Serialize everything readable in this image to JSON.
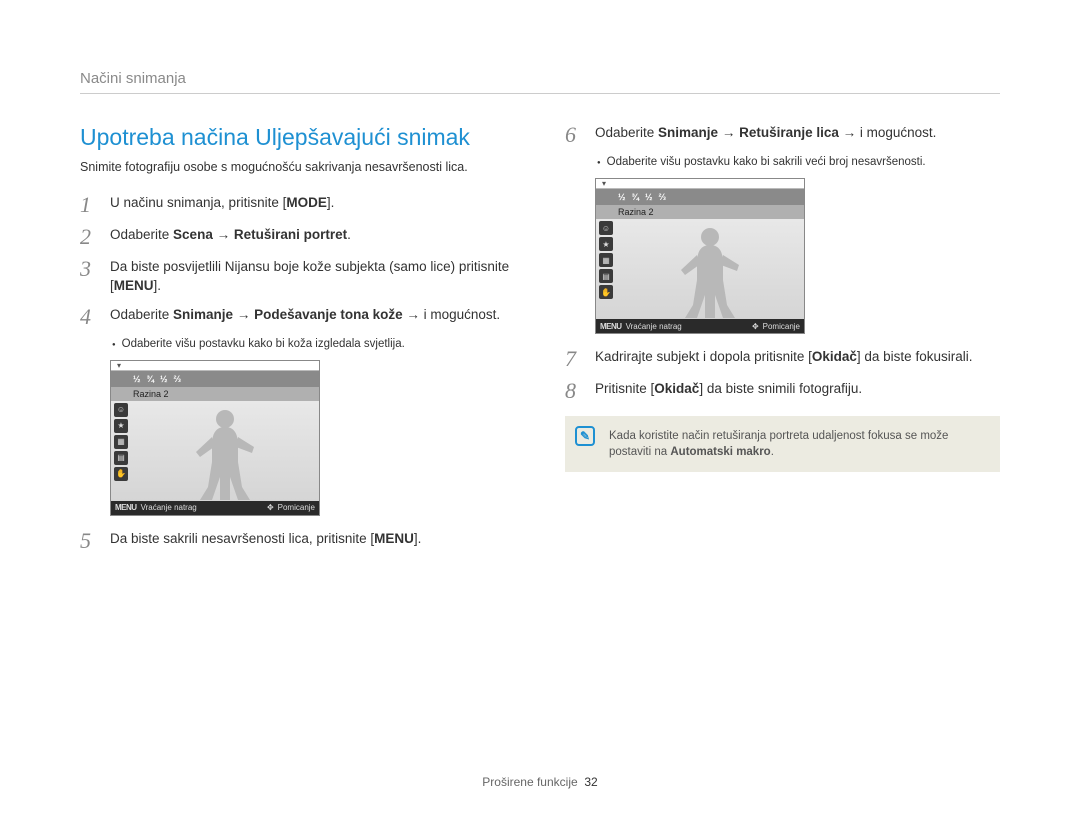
{
  "breadcrumb": "Načini snimanja",
  "section_title": "Upotreba načina Uljepšavajući snimak",
  "intro": "Snimite fotografiju osobe s mogućnošću sakrivanja nesavršenosti lica.",
  "steps_left": [
    {
      "n": "1",
      "html": "U načinu snimanja, pritisnite [<b>MODE</b>]."
    },
    {
      "n": "2",
      "html": "Odaberite <b>Scena → Retuširani portret</b>."
    },
    {
      "n": "3",
      "html": "Da biste posvijetlili Nijansu boje kože subjekta (samo lice) pritisnite [<b>MENU</b>]."
    },
    {
      "n": "4",
      "html": "Odaberite <b>Snimanje → Podešavanje tona kože →</b> i mogućnost."
    }
  ],
  "sub_bullet_left": "Odaberite višu postavku kako bi koža izgledala svjetlija.",
  "step5": {
    "n": "5",
    "html": "Da biste sakrili nesavršenosti lica, pritisnite [<b>MENU</b>]."
  },
  "steps_right": [
    {
      "n": "6",
      "html": "Odaberite <b>Snimanje → Retuširanje lica →</b> i mogućnost."
    }
  ],
  "sub_bullet_right": "Odaberite višu postavku kako bi sakrili veći broj nesavršenosti.",
  "step7": {
    "n": "7",
    "html": "Kadrirajte subjekt i dopola pritisnite [<b>Okidač</b>] da biste fokusirali."
  },
  "step8": {
    "n": "8",
    "html": "Pritisnite [<b>Okidač</b>] da biste snimili fotografiju."
  },
  "note": {
    "pre": "Kada koristite način retuširanja portreta udaljenost fokusa se može postaviti na ",
    "bold": "Automatski makro",
    "post": "."
  },
  "lcd": {
    "strip_values": [
      "½",
      "¾",
      "½",
      "⅔"
    ],
    "level_label": "Razina 2",
    "footer_menu": "MENU",
    "footer_back": "Vraćanje natrag",
    "footer_move_icon": "✥",
    "footer_move": "Pomicanje"
  },
  "footer_label": "Proširene funkcije",
  "footer_page": "32"
}
